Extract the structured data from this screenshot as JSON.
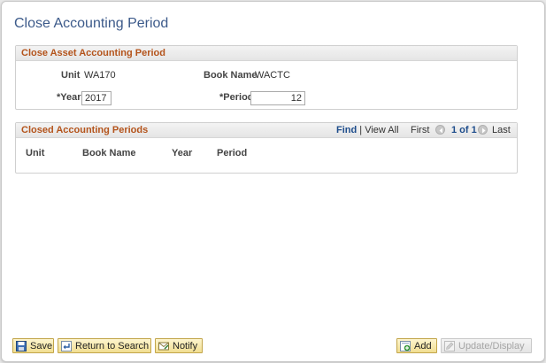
{
  "page": {
    "title": "Close Accounting Period"
  },
  "close_group": {
    "title": "Close Asset Accounting Period",
    "unit_label": "Unit",
    "unit_value": "WA170",
    "book_name_label": "Book Name",
    "book_name_value": "WACTC",
    "year_label": "*Year",
    "year_value": "2017",
    "period_label": "*Period",
    "period_value": "12"
  },
  "closed_group": {
    "title": "Closed Accounting Periods",
    "find_label": "Find",
    "separator": "|",
    "view_all_label": "View All",
    "first_label": "First",
    "page_indicator": "1 of 1",
    "last_label": "Last",
    "columns": [
      "Unit",
      "Book Name",
      "Year",
      "Period"
    ]
  },
  "toolbar": {
    "save_label": "Save",
    "return_label": "Return to Search",
    "notify_label": "Notify",
    "add_label": "Add",
    "update_label": "Update/Display"
  },
  "icons": {
    "save": "floppy-disk-icon",
    "return": "return-arrow-icon",
    "notify": "notify-icon",
    "add": "add-icon",
    "update": "update-display-icon",
    "prev": "previous-arrow-icon",
    "next": "next-arrow-icon"
  },
  "colors": {
    "title": "#3c5a8a",
    "group_title": "#b4541c",
    "link": "#1e4d8c"
  }
}
